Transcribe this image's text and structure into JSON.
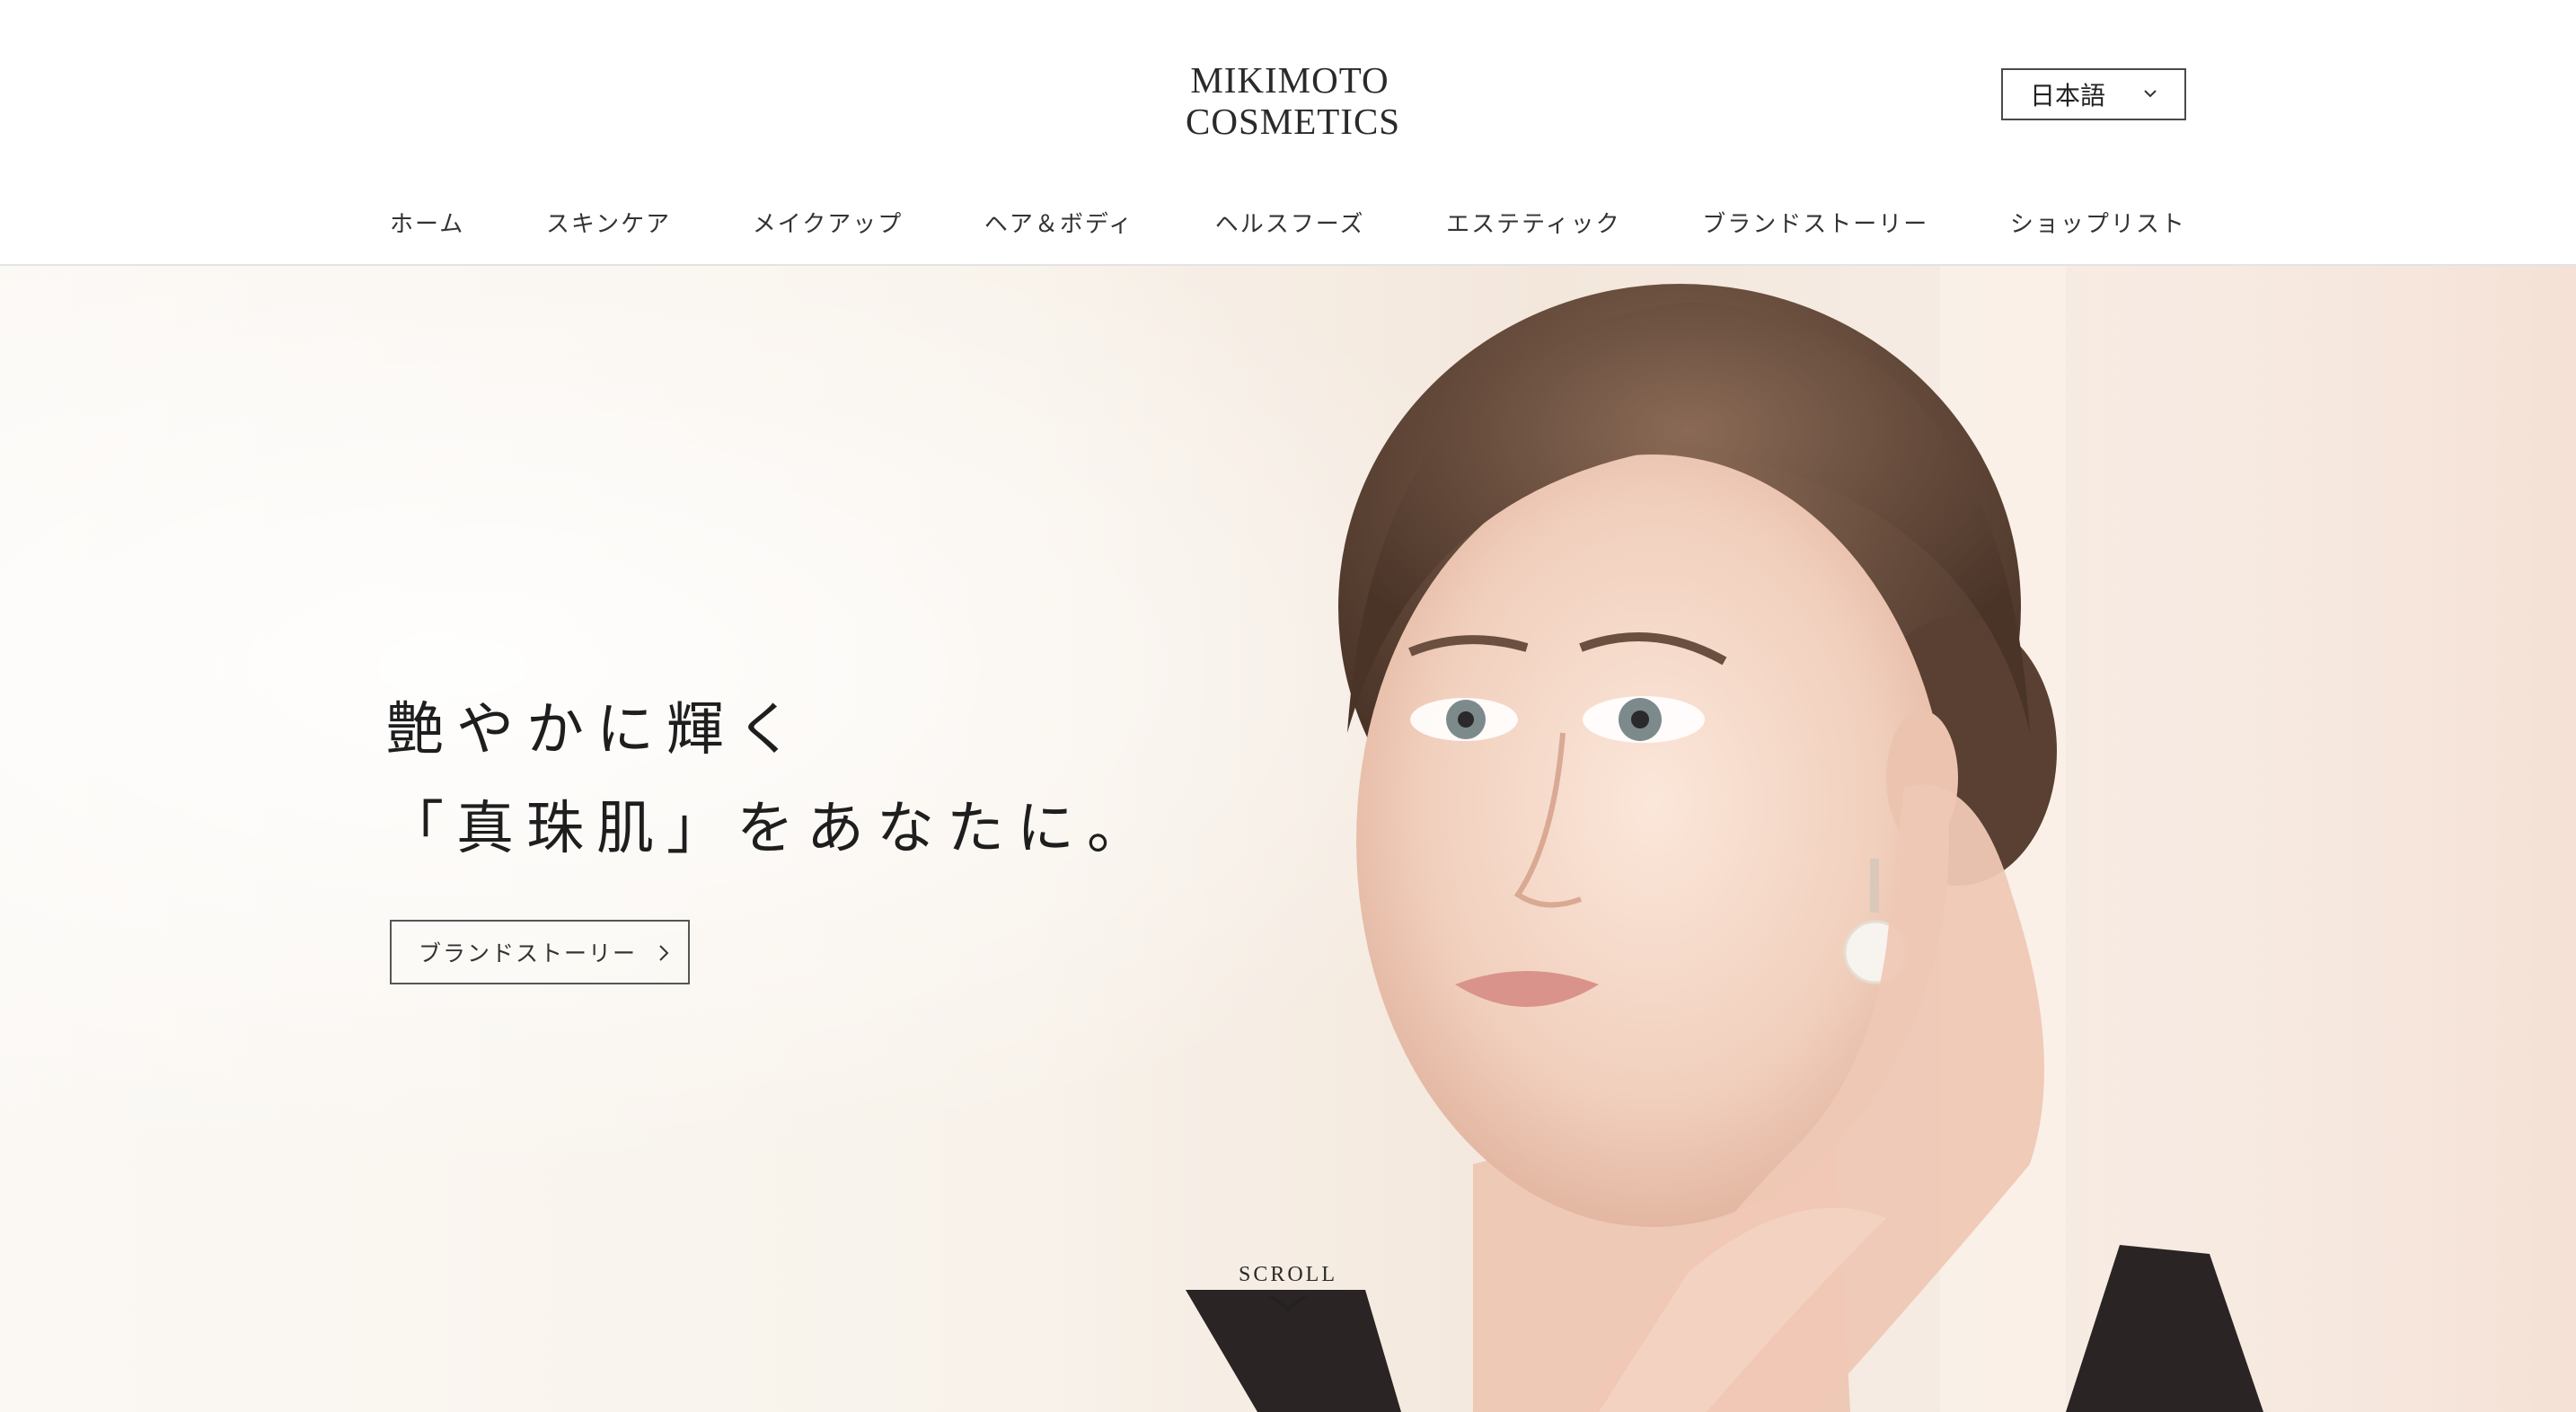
{
  "brand": {
    "line1": "MIKIMOTO",
    "line2": "COSMETICS"
  },
  "language_select": {
    "value": "日本語",
    "icon": "chevron-down-icon"
  },
  "nav": {
    "items": [
      {
        "label": "ホーム"
      },
      {
        "label": "スキンケア"
      },
      {
        "label": "メイクアップ"
      },
      {
        "label": "ヘア＆ボディ"
      },
      {
        "label": "ヘルスフーズ"
      },
      {
        "label": "エステティック"
      },
      {
        "label": "ブランドストーリー"
      },
      {
        "label": "ショップリスト"
      }
    ]
  },
  "hero": {
    "headline_line1": "艶やかに輝く",
    "headline_line2": "「真珠肌」をあなたに。",
    "cta_label": "ブランドストーリー",
    "cta_icon": "chevron-right-icon",
    "scroll_label": "SCROLL",
    "scroll_icon": "chevron-down-icon"
  },
  "colors": {
    "header_bg": "#ffffff",
    "hero_bg": "#f8f1e9",
    "text": "#222222",
    "border": "#4a4a4a"
  }
}
